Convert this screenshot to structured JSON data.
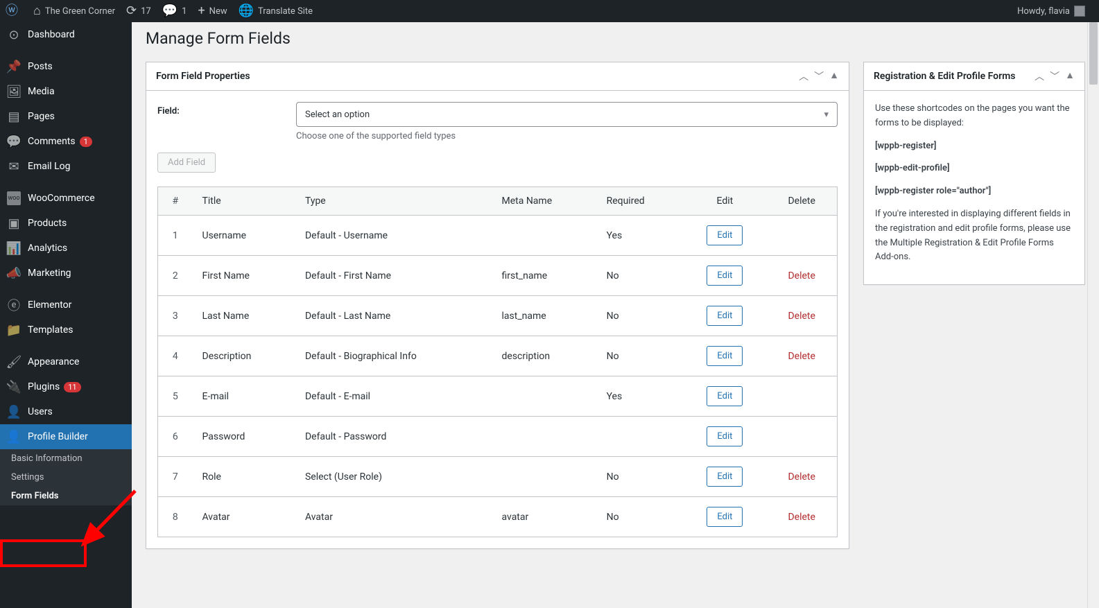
{
  "adminbar": {
    "site_title": "The Green Corner",
    "refresh_count": "17",
    "comments_count": "1",
    "new_label": "New",
    "translate_label": "Translate Site",
    "howdy": "Howdy, flavia"
  },
  "sidebar": {
    "dashboard": "Dashboard",
    "posts": "Posts",
    "media": "Media",
    "pages": "Pages",
    "comments": "Comments",
    "comments_count": "1",
    "email_log": "Email Log",
    "woocommerce": "WooCommerce",
    "products": "Products",
    "analytics": "Analytics",
    "marketing": "Marketing",
    "elementor": "Elementor",
    "templates": "Templates",
    "appearance": "Appearance",
    "plugins": "Plugins",
    "plugins_count": "11",
    "users": "Users",
    "profile_builder": "Profile Builder",
    "submenu": {
      "basic_info": "Basic Information",
      "settings": "Settings",
      "form_fields": "Form Fields"
    }
  },
  "page": {
    "title": "Manage Form Fields"
  },
  "properties": {
    "heading": "Form Field Properties",
    "field_label": "Field:",
    "select_placeholder": "Select an option",
    "select_desc": "Choose one of the supported field types",
    "add_button": "Add Field"
  },
  "table": {
    "headers": {
      "num": "#",
      "title": "Title",
      "type": "Type",
      "meta": "Meta Name",
      "required": "Required",
      "edit": "Edit",
      "delete": "Delete"
    },
    "edit_label": "Edit",
    "delete_label": "Delete",
    "rows": [
      {
        "num": "1",
        "title": "Username",
        "type": "Default - Username",
        "meta": "",
        "required": "Yes",
        "deletable": false
      },
      {
        "num": "2",
        "title": "First Name",
        "type": "Default - First Name",
        "meta": "first_name",
        "required": "No",
        "deletable": true
      },
      {
        "num": "3",
        "title": "Last Name",
        "type": "Default - Last Name",
        "meta": "last_name",
        "required": "No",
        "deletable": true
      },
      {
        "num": "4",
        "title": "Description",
        "type": "Default - Biographical Info",
        "meta": "description",
        "required": "No",
        "deletable": true
      },
      {
        "num": "5",
        "title": "E-mail",
        "type": "Default - E-mail",
        "meta": "",
        "required": "Yes",
        "deletable": false
      },
      {
        "num": "6",
        "title": "Password",
        "type": "Default - Password",
        "meta": "",
        "required": "",
        "deletable": false
      },
      {
        "num": "7",
        "title": "Role",
        "type": "Select (User Role)",
        "meta": "",
        "required": "No",
        "deletable": true
      },
      {
        "num": "8",
        "title": "Avatar",
        "type": "Avatar",
        "meta": "avatar",
        "required": "No",
        "deletable": true
      }
    ]
  },
  "sidepanel": {
    "heading": "Registration & Edit Profile Forms",
    "intro": "Use these shortcodes on the pages you want the forms to be displayed:",
    "code1": "[wppb-register]",
    "code2": "[wppb-edit-profile]",
    "code3": "[wppb-register role=\"author\"]",
    "footer": "If you're interested in displaying different fields in the registration and edit profile forms, please use the Multiple Registration & Edit Profile Forms Add-ons."
  }
}
